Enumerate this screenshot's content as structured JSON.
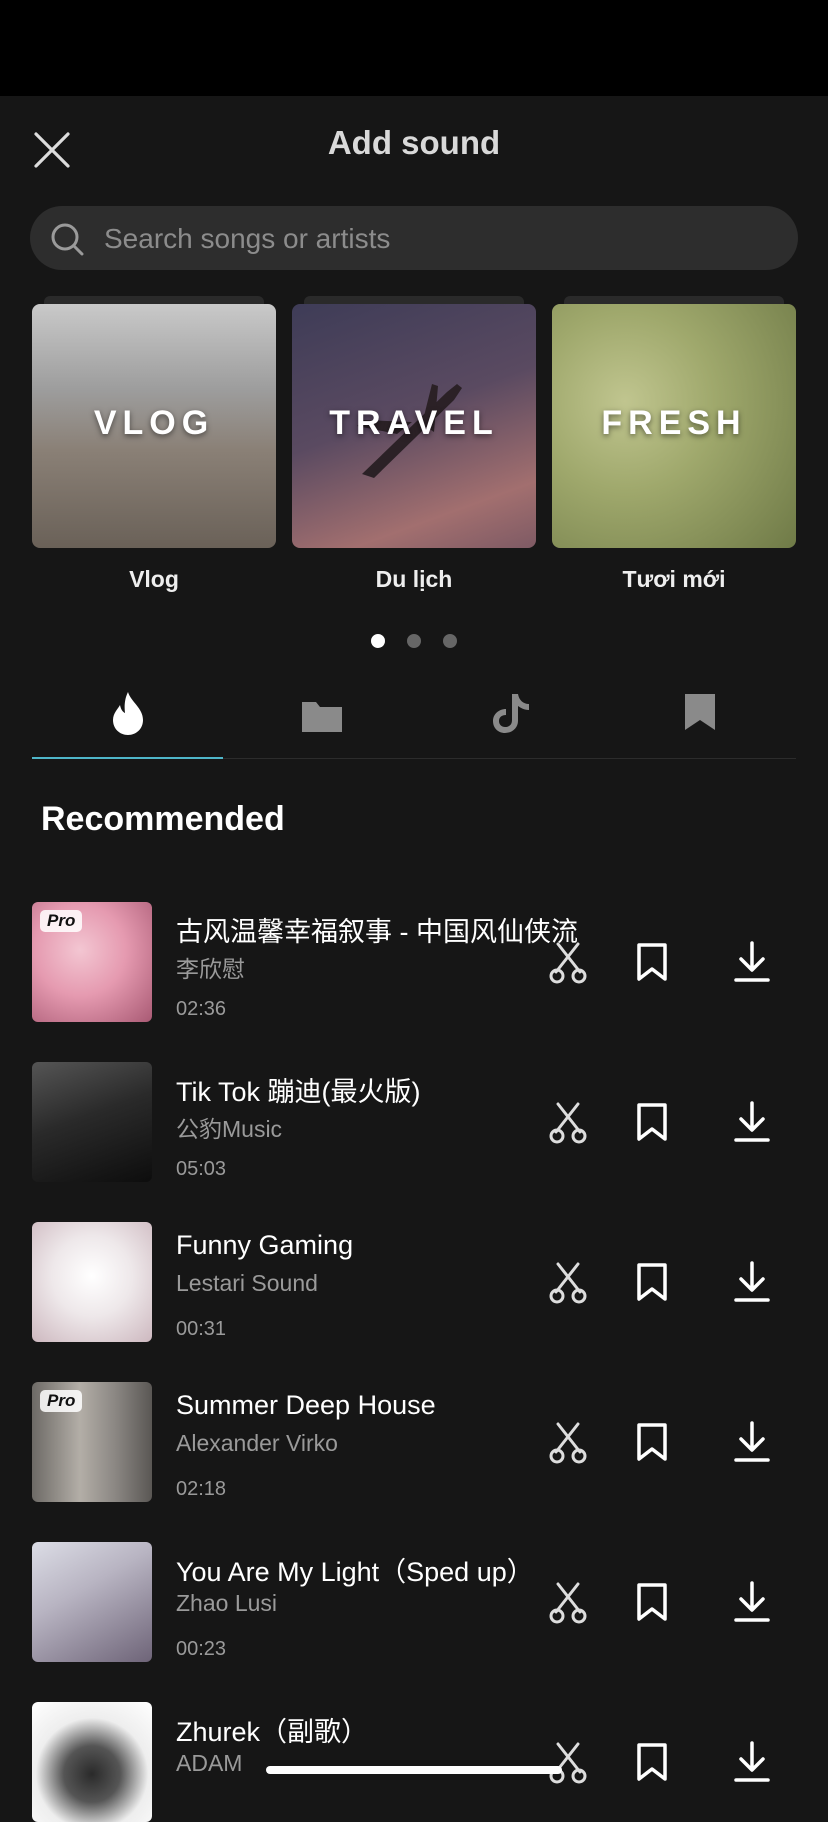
{
  "header": {
    "title": "Add sound"
  },
  "search": {
    "placeholder": "Search songs or artists"
  },
  "categories": [
    {
      "overlay": "VLOG",
      "label": "Vlog"
    },
    {
      "overlay": "TRAVEL",
      "label": "Du lịch"
    },
    {
      "overlay": "FRESH",
      "label": "Tươi mới"
    }
  ],
  "pagination": {
    "pages": 3,
    "active": 1
  },
  "tabs": [
    {
      "icon": "flame-icon",
      "active": true
    },
    {
      "icon": "folder-icon",
      "active": false
    },
    {
      "icon": "tiktok-icon",
      "active": false
    },
    {
      "icon": "bookmark-icon",
      "active": false
    }
  ],
  "section": {
    "title": "Recommended"
  },
  "tracks": [
    {
      "name": "古风温馨幸福叙事 - 中国风仙侠流",
      "artist": "李欣慰",
      "duration": "02:36",
      "pro": "Pro"
    },
    {
      "name": "Tik Tok 蹦迪(最火版)",
      "artist": "公豹Music",
      "duration": "05:03",
      "pro": ""
    },
    {
      "name": "Funny Gaming",
      "artist": "Lestari Sound",
      "duration": "00:31",
      "pro": ""
    },
    {
      "name": "Summer Deep House",
      "artist": "Alexander Virko",
      "duration": "02:18",
      "pro": "Pro"
    },
    {
      "name": "You Are My Light（Sped up）",
      "artist": "Zhao Lusi",
      "duration": "00:23",
      "pro": ""
    },
    {
      "name": "Zhurek（副歌）",
      "artist": "ADAM",
      "duration": "",
      "pro": ""
    }
  ],
  "colors": {
    "background": "#161616",
    "accent": "#4fb6c9",
    "search_bg": "#2d2d2d"
  }
}
